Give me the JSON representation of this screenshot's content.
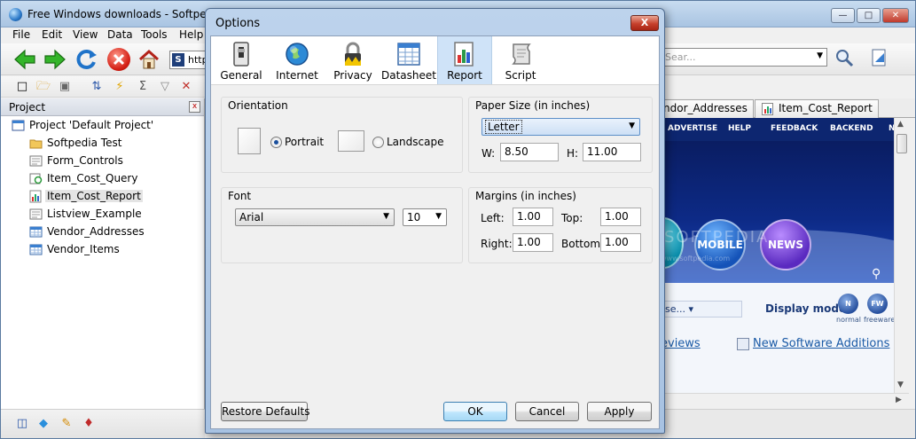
{
  "main_window": {
    "title": "Free Windows downloads - Softpedia",
    "menu": [
      "File",
      "Edit",
      "View",
      "Data",
      "Tools",
      "Help"
    ],
    "address_text": "http",
    "search_placeholder": "Sear..."
  },
  "project_panel": {
    "header": "Project",
    "items": [
      {
        "label": "Project 'Default Project'",
        "icon": "project-icon",
        "indent": 0
      },
      {
        "label": "Softpedia Test",
        "icon": "folder-icon",
        "indent": 1
      },
      {
        "label": "Form_Controls",
        "icon": "form-icon",
        "indent": 1
      },
      {
        "label": "Item_Cost_Query",
        "icon": "query-icon",
        "indent": 1
      },
      {
        "label": "Item_Cost_Report",
        "icon": "report-icon",
        "indent": 1,
        "selected": true
      },
      {
        "label": "Listview_Example",
        "icon": "form-icon",
        "indent": 1
      },
      {
        "label": "Vendor_Addresses",
        "icon": "datasheet-icon",
        "indent": 1
      },
      {
        "label": "Vendor_Items",
        "icon": "datasheet-icon",
        "indent": 1
      }
    ]
  },
  "doc_tabs": [
    {
      "label": "ndor_Addresses",
      "icon": "datasheet-icon"
    },
    {
      "label": "Item_Cost_Report",
      "icon": "report-icon"
    }
  ],
  "web": {
    "nav": [
      "ADVERTISE",
      "HELP",
      "FEEDBACK",
      "BACKEND",
      "N"
    ],
    "orb_mobile": "MOBILE",
    "orb_news": "NEWS",
    "watermark": "SOFTPEDIA",
    "watermark_sub": "www.softpedia.com",
    "search_label": "S",
    "browse_text": "se...",
    "display_mode_label": "Display mode:",
    "modes": [
      {
        "glyph": "N",
        "caption": "normal"
      },
      {
        "glyph": "FW",
        "caption": "freeware"
      }
    ],
    "reviews_link": "eviews",
    "new_software_link": "New Software Additions"
  },
  "dialog": {
    "title": "Options",
    "close_glyph": "X",
    "tabs": [
      {
        "label": "General",
        "icon": "general-icon"
      },
      {
        "label": "Internet",
        "icon": "globe-icon"
      },
      {
        "label": "Privacy",
        "icon": "lock-icon"
      },
      {
        "label": "Datasheet",
        "icon": "datasheet-icon"
      },
      {
        "label": "Report",
        "icon": "report-icon",
        "active": true
      },
      {
        "label": "Script",
        "icon": "script-icon"
      }
    ],
    "orientation": {
      "title": "Orientation",
      "portrait": "Portrait",
      "landscape": "Landscape",
      "selected": "Portrait"
    },
    "paper": {
      "title": "Paper Size (in inches)",
      "size": "Letter",
      "w_label": "W:",
      "w_value": "8.50",
      "h_label": "H:",
      "h_value": "11.00"
    },
    "font": {
      "title": "Font",
      "family": "Arial",
      "size": "10"
    },
    "margins": {
      "title": "Margins (in inches)",
      "left_label": "Left:",
      "left_value": "1.00",
      "top_label": "Top:",
      "top_value": "1.00",
      "right_label": "Right:",
      "right_value": "1.00",
      "bottom_label": "Bottom:",
      "bottom_value": "1.00"
    },
    "buttons": {
      "restore": "Restore Defaults",
      "ok": "OK",
      "cancel": "Cancel",
      "apply": "Apply"
    }
  },
  "colors": {
    "accent": "#cfe3f8",
    "title_bar": "#a9c4e2",
    "web_navy": "#0d2670",
    "link": "#1a5aa6"
  }
}
